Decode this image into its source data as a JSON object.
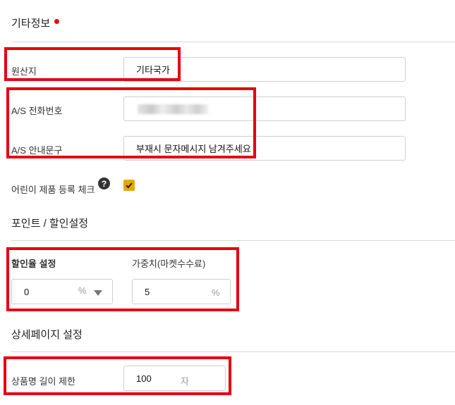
{
  "extra_info": {
    "title": "기타정보",
    "origin": {
      "label": "원산지",
      "value": "기타국가"
    },
    "as_phone": {
      "label": "A/S 전화번호"
    },
    "as_notice": {
      "label": "A/S 안내문구",
      "value": "부재시 문자메시지 남겨주세요"
    },
    "kids_product": {
      "label": "어린이 제품 등록 체크",
      "help": "?",
      "checked": true
    }
  },
  "point_discount": {
    "title": "포인트 / 할인설정",
    "discount_rate": {
      "label": "할인율 설정",
      "value": "0",
      "unit": "%"
    },
    "weight": {
      "label": "가중치(마켓수수료)",
      "value": "5",
      "unit": "%"
    }
  },
  "detail_page": {
    "title": "상세페이지 설정",
    "name_limit": {
      "label": "상품명 길이 제한",
      "value": "100",
      "unit": "자"
    }
  },
  "colors": {
    "accent": "#e6a700",
    "highlight": "#e60012",
    "required": "#e60012"
  }
}
